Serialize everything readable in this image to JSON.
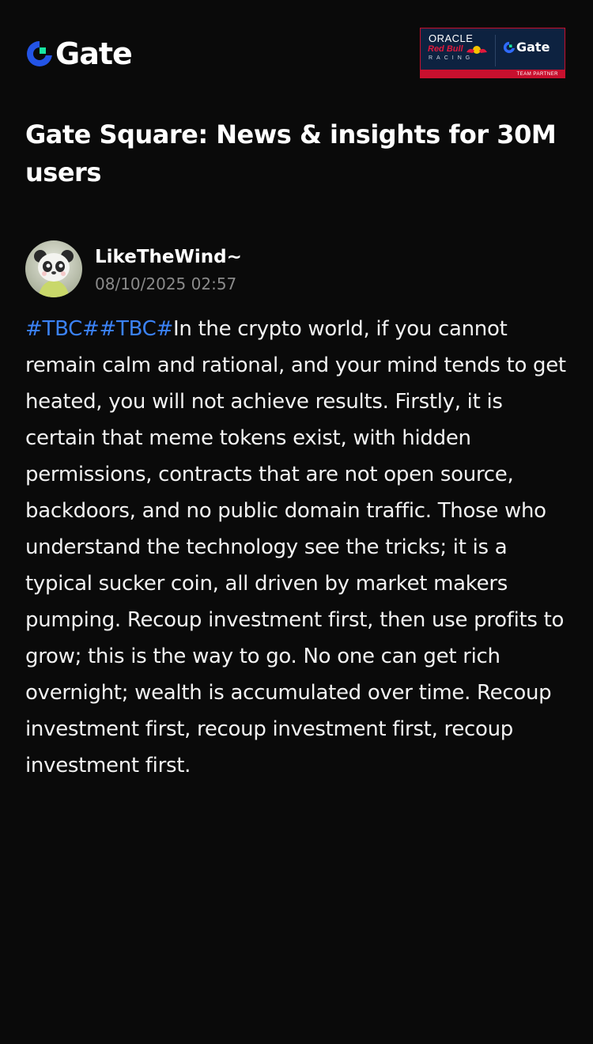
{
  "brand": {
    "name": "Gate",
    "accent_blue": "#2354e6",
    "accent_green": "#17e6a1"
  },
  "partner_badge": {
    "line1": "ORACLE",
    "line2": "Red Bull",
    "line3": "RACING",
    "partner_name": "Gate",
    "strip_text": "TEAM PARTNER",
    "border_color": "#c8102e"
  },
  "page": {
    "title": "Gate Square: News & insights for 30M users"
  },
  "post": {
    "author": "LikeTheWind~",
    "timestamp": "08/10/2025 02:57",
    "hashtags": [
      "#TBC#",
      "#TBC#"
    ],
    "hashtag_color": "#3b82f6",
    "text": "In the crypto world, if you cannot remain calm and rational, and your mind tends to get heated, you will not achieve results. Firstly, it is certain that meme tokens exist, with hidden permissions, contracts that are not open source, backdoors, and no public domain traffic. Those who understand the technology see the tricks; it is a typical sucker coin, all driven by market makers pumping. Recoup investment first, then use profits to grow; this is the way to go. No one can get rich overnight; wealth is accumulated over time. Recoup investment first, recoup investment first, recoup investment first."
  }
}
